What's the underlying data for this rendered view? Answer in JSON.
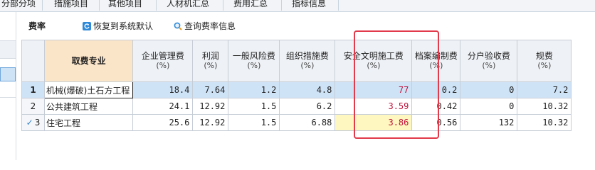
{
  "tabs": [
    "分部分项",
    "措施项目",
    "其他项目",
    "人材机汇总",
    "费用汇总",
    "指标信息"
  ],
  "toolbar": {
    "title": "费率",
    "restore_label": "恢复到系统默认",
    "query_label": "查询费率信息"
  },
  "table": {
    "headers": [
      {
        "name": "取费专业",
        "unit": ""
      },
      {
        "name": "企业管理费",
        "unit": "(%)"
      },
      {
        "name": "利润",
        "unit": "(%)"
      },
      {
        "name": "一般风险费",
        "unit": "(%)"
      },
      {
        "name": "组织措施费",
        "unit": "(%)"
      },
      {
        "name": "安全文明施工费",
        "unit": "(%)"
      },
      {
        "name": "档案编制费",
        "unit": "(%)"
      },
      {
        "name": "分户验收费",
        "unit": "(%)"
      },
      {
        "name": "规费",
        "unit": "(%)"
      }
    ],
    "rows": [
      {
        "idx": "1",
        "name": "机械(爆破)土石方工程",
        "values": [
          "18.4",
          "7.64",
          "1.2",
          "4.8",
          "77",
          "0.2",
          "0",
          "7.2"
        ]
      },
      {
        "idx": "2",
        "name": "公共建筑工程",
        "values": [
          "24.1",
          "12.92",
          "1.5",
          "6.2",
          "3.59",
          "0.42",
          "0",
          "10.32"
        ]
      },
      {
        "idx": "3",
        "name": "住宅工程",
        "values": [
          "25.6",
          "12.92",
          "1.5",
          "6.88",
          "3.86",
          "0.56",
          "132",
          "10.32"
        ]
      }
    ]
  },
  "colors": {
    "highlight_box": "#e23a4a",
    "value_red": "#c0143c",
    "selected_row": "#cfe3f7",
    "header_highlight": "#fbe5c8"
  }
}
